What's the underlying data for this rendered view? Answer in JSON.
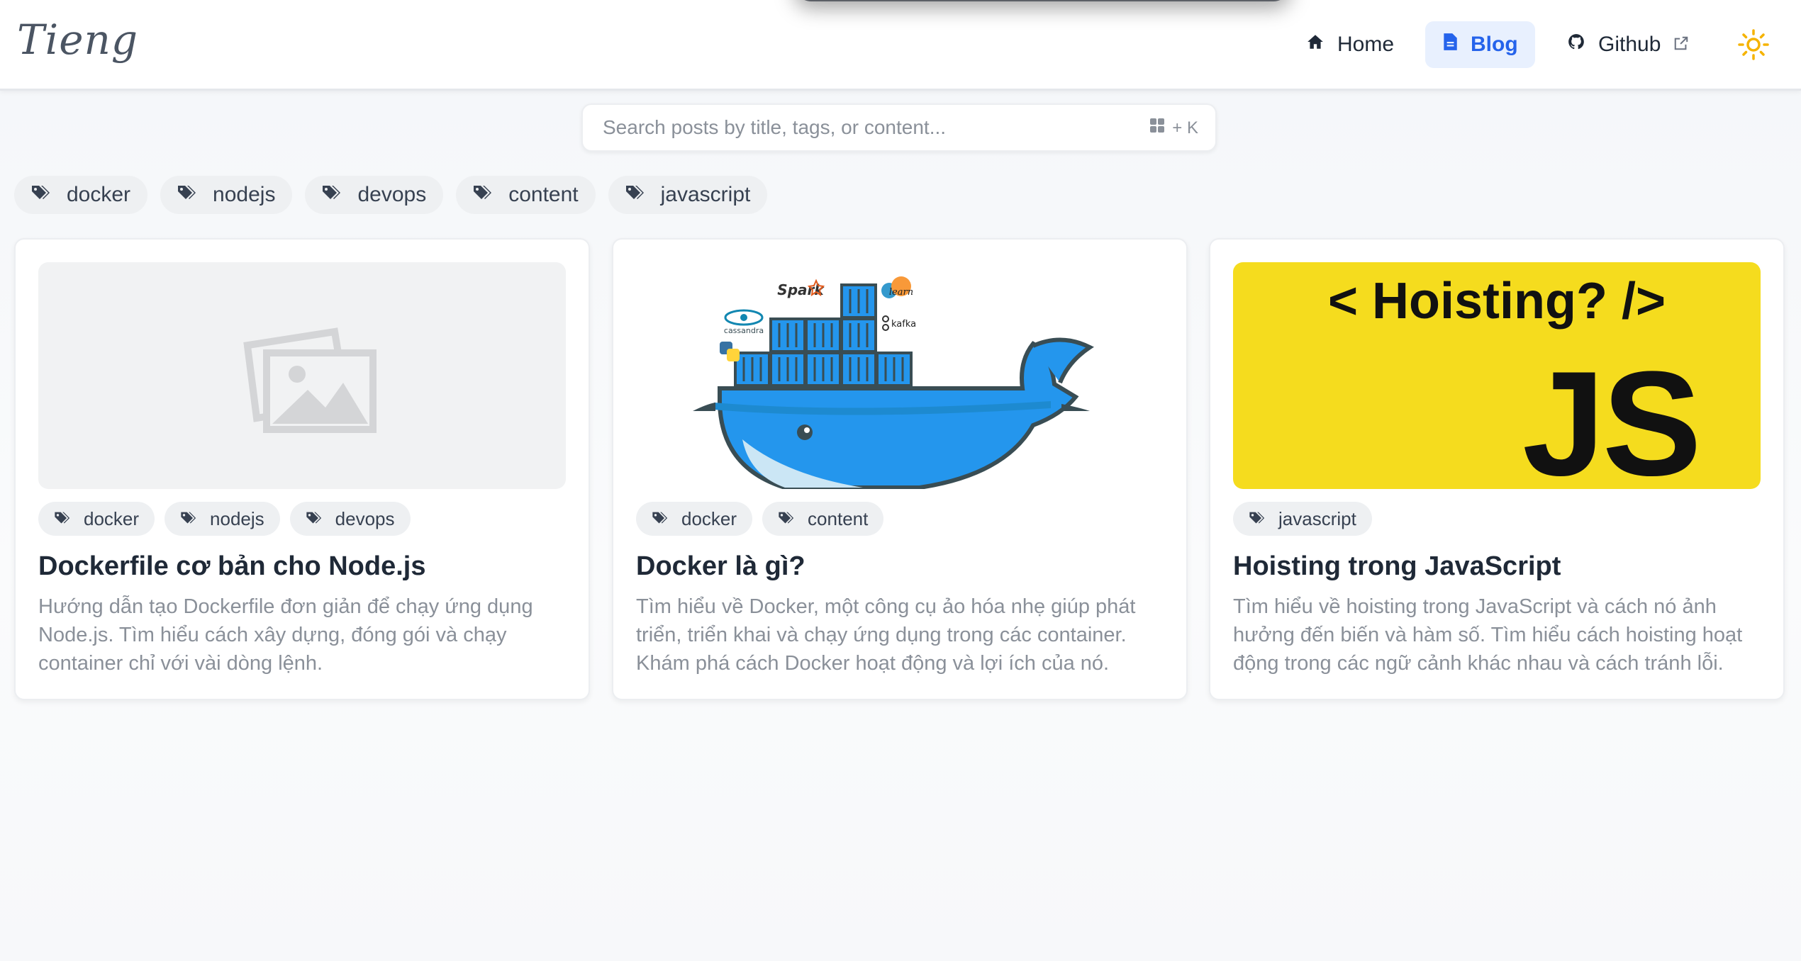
{
  "header": {
    "logo": "Tieng",
    "nav": [
      {
        "label": "Home",
        "icon": "home-icon"
      },
      {
        "label": "Blog",
        "icon": "document-icon",
        "active": true
      },
      {
        "label": "Github",
        "icon": "github-icon",
        "external": true
      }
    ],
    "theme_icon": "sun-icon"
  },
  "search": {
    "placeholder": "Search posts by title, tags, or content...",
    "shortcut": "+ K"
  },
  "filter_tags": [
    "docker",
    "nodejs",
    "devops",
    "content",
    "javascript"
  ],
  "posts": [
    {
      "title": "Dockerfile cơ bản cho Node.js",
      "excerpt": "Hướng dẫn tạo Dockerfile đơn giản để chạy ứng dụng Node.js. Tìm hiểu cách xây dựng, đóng gói và chạy container chỉ với vài dòng lệnh.",
      "tags": [
        "docker",
        "nodejs",
        "devops"
      ],
      "thumbnail": "image-placeholder-icon"
    },
    {
      "title": "Docker là gì?",
      "excerpt": "Tìm hiểu về Docker, một công cụ ảo hóa nhẹ giúp phát triển, triển khai và chạy ứng dụng trong các container. Khám phá cách Docker hoạt động và lợi ích của nó.",
      "tags": [
        "docker",
        "content"
      ],
      "thumbnail": "docker-whale-illustration",
      "thumb_labels": [
        "Spark",
        "cassandra",
        "kafka",
        "learn"
      ]
    },
    {
      "title": "Hoisting trong JavaScript",
      "excerpt": "Tìm hiểu về hoisting trong JavaScript và cách nó ảnh hưởng đến biến và hàm số. Tìm hiểu cách hoisting hoạt động trong các ngữ cảnh khác nhau và cách tránh lỗi.",
      "tags": [
        "javascript"
      ],
      "thumbnail": "js-hoisting-banner",
      "thumb_heading": "< Hoisting? />",
      "thumb_logo": "JS"
    }
  ],
  "colors": {
    "accent": "#2563eb",
    "accent_bg": "#e8f0fe",
    "chip_bg": "#eef0f2",
    "js_yellow": "#f5dc1e",
    "docker_blue": "#2496ed",
    "sun": "#f5b301"
  }
}
